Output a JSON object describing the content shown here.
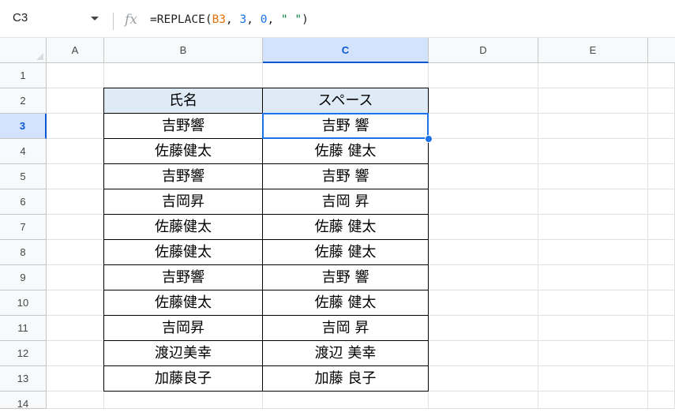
{
  "formula_bar": {
    "cell_ref": "C3",
    "fx_label": "fx",
    "formula": {
      "prefix": "=REPLACE(",
      "arg_ref": "B3",
      "sep1": ", ",
      "arg_start": "3",
      "sep2": ", ",
      "arg_len": "0",
      "sep3": ", ",
      "arg_text": "\" \"",
      "suffix": ")"
    }
  },
  "columns": [
    "A",
    "B",
    "C",
    "D",
    "E"
  ],
  "selected_column": "C",
  "rows": [
    "1",
    "2",
    "3",
    "4",
    "5",
    "6",
    "7",
    "8",
    "9",
    "10",
    "11",
    "12",
    "13",
    "14"
  ],
  "selected_row": "3",
  "table": {
    "headers": [
      "氏名",
      "スペース"
    ],
    "rows": [
      [
        "吉野響",
        "吉野 響"
      ],
      [
        "佐藤健太",
        "佐藤 健太"
      ],
      [
        "吉野響",
        "吉野 響"
      ],
      [
        "吉岡昇",
        "吉岡 昇"
      ],
      [
        "佐藤健太",
        "佐藤 健太"
      ],
      [
        "佐藤健太",
        "佐藤 健太"
      ],
      [
        "吉野響",
        "吉野 響"
      ],
      [
        "佐藤健太",
        "佐藤 健太"
      ],
      [
        "吉岡昇",
        "吉岡 昇"
      ],
      [
        "渡辺美幸",
        "渡辺 美幸"
      ],
      [
        "加藤良子",
        "加藤 良子"
      ]
    ]
  },
  "colors": {
    "header_fill": "#deeaf6",
    "selection": "#1a73e8",
    "selected_header": "#d3e3fd"
  }
}
